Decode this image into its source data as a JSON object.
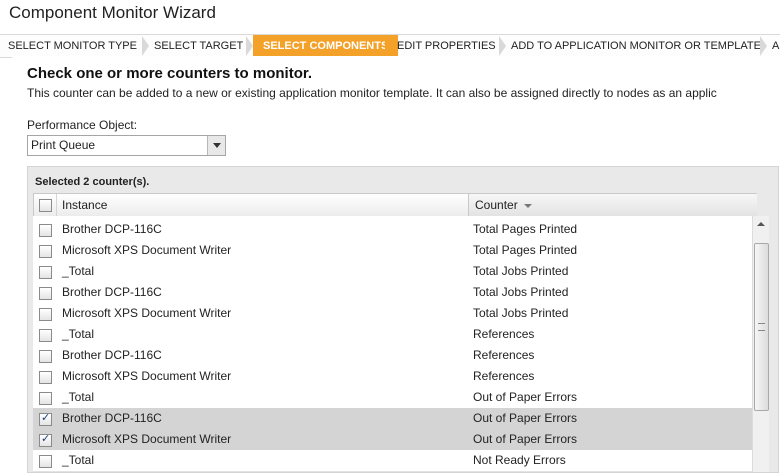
{
  "title": "Component Monitor Wizard",
  "steps": [
    {
      "label": "SELECT MONITOR TYPE"
    },
    {
      "label": "SELECT TARGET"
    },
    {
      "label": "SELECT COMPONENTS",
      "active": true
    },
    {
      "label": "EDIT PROPERTIES"
    },
    {
      "label": "ADD TO APPLICATION MONITOR OR TEMPLATE"
    },
    {
      "label": "A"
    }
  ],
  "heading": "Check one or more counters to monitor.",
  "description": "This counter can be added to a new or existing application monitor template. It can also be assigned directly to nodes as an applic",
  "performance_object": {
    "label": "Performance Object:",
    "value": "Print Queue"
  },
  "grid": {
    "selected_text": "Selected 2 counter(s).",
    "columns": {
      "instance": "Instance",
      "counter": "Counter"
    },
    "rows": [
      {
        "instance": "Brother DCP-116C",
        "counter": "Total Pages Printed",
        "checked": false
      },
      {
        "instance": "Microsoft XPS Document Writer",
        "counter": "Total Pages Printed",
        "checked": false
      },
      {
        "instance": "_Total",
        "counter": "Total Jobs Printed",
        "checked": false
      },
      {
        "instance": "Brother DCP-116C",
        "counter": "Total Jobs Printed",
        "checked": false
      },
      {
        "instance": "Microsoft XPS Document Writer",
        "counter": "Total Jobs Printed",
        "checked": false
      },
      {
        "instance": "_Total",
        "counter": "References",
        "checked": false
      },
      {
        "instance": "Brother DCP-116C",
        "counter": "References",
        "checked": false
      },
      {
        "instance": "Microsoft XPS Document Writer",
        "counter": "References",
        "checked": false
      },
      {
        "instance": "_Total",
        "counter": "Out of Paper Errors",
        "checked": false
      },
      {
        "instance": "Brother DCP-116C",
        "counter": "Out of Paper Errors",
        "checked": true
      },
      {
        "instance": "Microsoft XPS Document Writer",
        "counter": "Out of Paper Errors",
        "checked": true
      },
      {
        "instance": "_Total",
        "counter": "Not Ready Errors",
        "checked": false
      }
    ]
  }
}
